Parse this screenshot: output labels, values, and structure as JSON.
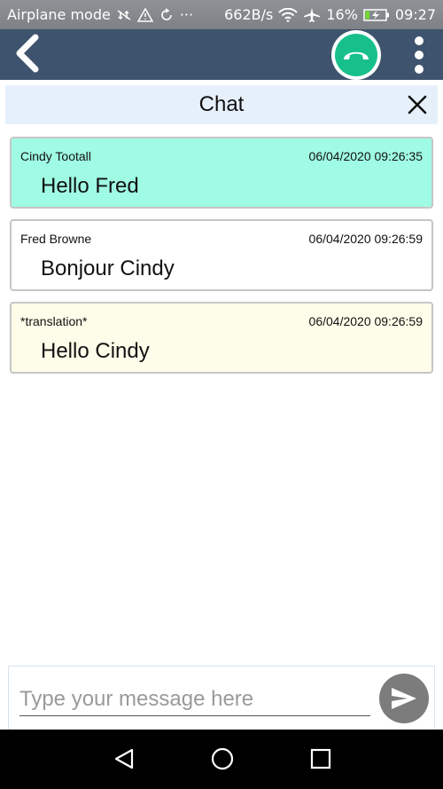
{
  "status_bar": {
    "mode": "Airplane mode",
    "more": "···",
    "speed": "662B/s",
    "battery": "16%",
    "time": "09:27"
  },
  "app_bar": {
    "back_icon": "chevron-left-icon",
    "call_icon": "hang-up-icon",
    "menu_icon": "more-vertical-icon",
    "call_color": "#17c08a",
    "bar_color": "#3e536d"
  },
  "chat": {
    "title": "Chat",
    "close_icon": "close-icon"
  },
  "messages": [
    {
      "sender": "Cindy Tootall",
      "timestamp": "06/04/2020 09:26:35",
      "text": "Hello Fred",
      "bg": "#9ffbe4"
    },
    {
      "sender": "Fred Browne",
      "timestamp": "06/04/2020 09:26:59",
      "text": "Bonjour Cindy",
      "bg": "#ffffff"
    },
    {
      "sender": "*translation*",
      "timestamp": "06/04/2020 09:26:59",
      "text": "Hello Cindy",
      "bg": "#fdfde9"
    }
  ],
  "composer": {
    "placeholder": "Type your message here",
    "value": "",
    "send_icon": "send-icon"
  },
  "nav": {
    "back_icon": "nav-back-icon",
    "home_icon": "nav-home-icon",
    "recents_icon": "nav-recents-icon"
  }
}
